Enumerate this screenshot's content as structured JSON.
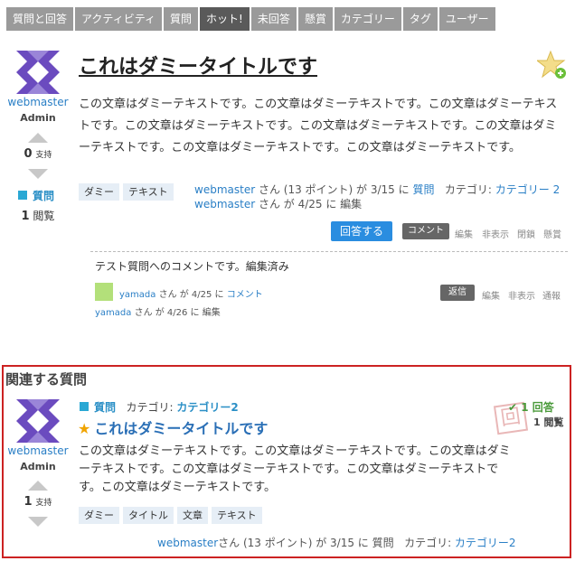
{
  "nav": {
    "tabs": [
      {
        "label": "質問と回答",
        "active": false
      },
      {
        "label": "アクティビティ",
        "active": false
      },
      {
        "label": "質問",
        "active": false
      },
      {
        "label": "ホット!",
        "active": true
      },
      {
        "label": "未回答",
        "active": false
      },
      {
        "label": "懸賞",
        "active": false
      },
      {
        "label": "カテゴリー",
        "active": false
      },
      {
        "label": "タグ",
        "active": false
      },
      {
        "label": "ユーザー",
        "active": false
      }
    ]
  },
  "question": {
    "title": "これはダミータイトルです",
    "author": "webmaster",
    "author_role": "Admin",
    "votes": "0",
    "votes_label": "支持",
    "type_label": "質問",
    "views": "1",
    "views_label": "閲覧",
    "body": "この文章はダミーテキストです。この文章はダミーテキストです。この文章はダミーテキストです。この文章はダミーテキストです。この文章はダミーテキストです。この文章はダミーテキストです。この文章はダミーテキストです。この文章はダミーテキストです。",
    "tags": [
      "ダミー",
      "テキスト"
    ],
    "meta_line1": {
      "user": "webmaster",
      "text": " さん (13 ポイント) が 3/15 に ",
      "type": "質問",
      "category_label": "カテゴリ: ",
      "category": "カテゴリー 2"
    },
    "meta_line2": {
      "user": "webmaster",
      "text": " さん が 4/25 に 編集"
    },
    "answer_button": "回答する",
    "comment_button": "コメント",
    "actions": [
      "編集",
      "非表示",
      "閉鎖",
      "懸賞"
    ]
  },
  "comment": {
    "text": "テスト質問へのコメントです。編集済み",
    "user": "yamada",
    "line1_text": " さん が 4/25 に ",
    "line1_link": "コメント",
    "line2_text": " さん が 4/26 に 編集",
    "reply_button": "返信",
    "actions": [
      "編集",
      "非表示",
      "通報"
    ]
  },
  "related": {
    "heading": "関連する質問",
    "author": "webmaster",
    "author_role": "Admin",
    "votes": "1",
    "votes_label": "支持",
    "type_label": "質問",
    "category_label": "カテゴリ: ",
    "category": "カテゴリー2",
    "title": "これはダミータイトルです",
    "answers": "1 回答",
    "views": "1 閲覧",
    "stamp": "回",
    "body": "この文章はダミーテキストです。この文章はダミーテキストです。この文章はダミーテキストです。この文章はダミーテキストです。この文章はダミーテキストです。この文章はダミーテキストです。",
    "tags": [
      "ダミー",
      "タイトル",
      "文章",
      "テキスト"
    ],
    "meta": {
      "user": "webmaster",
      "text": "さん (13 ポイント) が 3/15 に 質問",
      "category_label": "カテゴリ: ",
      "category": "カテゴリー2"
    }
  },
  "colors": {
    "nav_bg": "#9a9a9a",
    "nav_active": "#5a5a5a",
    "link": "#2a7fc6",
    "answer_button": "#2a8de0",
    "related_border": "#cc2222",
    "avatar": "#6b4bbf"
  }
}
